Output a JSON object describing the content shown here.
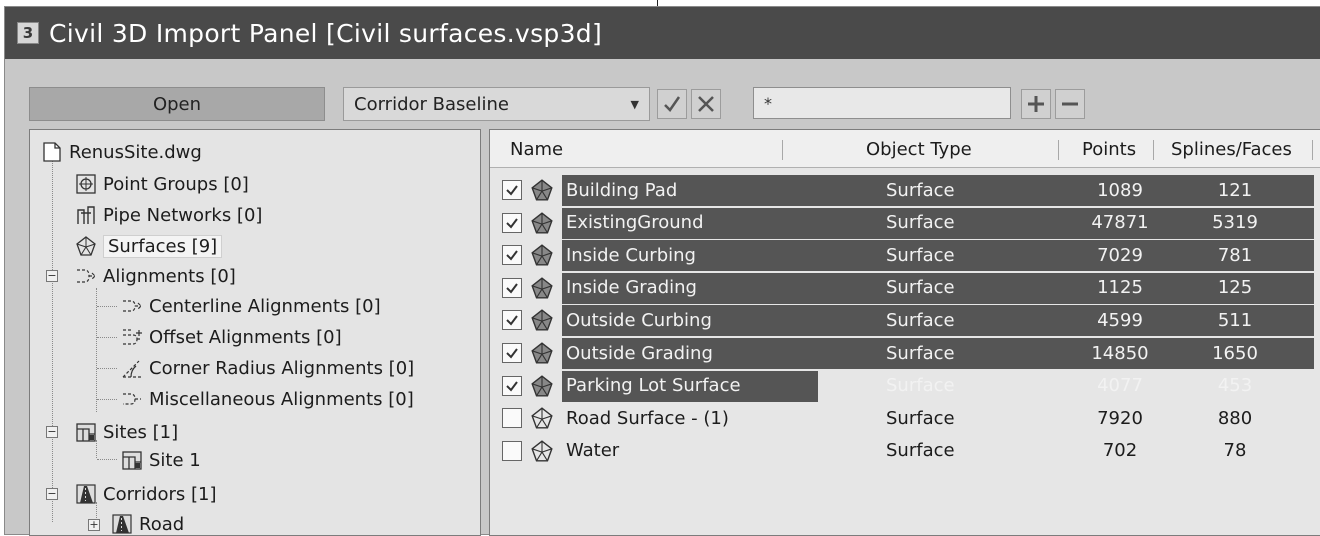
{
  "window": {
    "app_icon_text": "3",
    "title": "Civil 3D Import Panel [Civil surfaces.vsp3d]"
  },
  "toolbar": {
    "open_label": "Open",
    "combo_value": "Corridor Baseline",
    "filter_value": "*",
    "icons": [
      "check-icon",
      "x-icon",
      "plus-icon",
      "minus-icon"
    ]
  },
  "tree": {
    "root": "RenusSite.dwg",
    "items": [
      {
        "label": "Point Groups [0]",
        "icon": "point-groups-icon"
      },
      {
        "label": "Pipe Networks [0]",
        "icon": "pipe-networks-icon"
      },
      {
        "label": "Surfaces [9]",
        "icon": "surface-icon",
        "selected": true
      },
      {
        "label": "Alignments [0]",
        "icon": "alignment-icon"
      },
      {
        "label": "Centerline Alignments [0]",
        "icon": "centerline-alignment-icon"
      },
      {
        "label": "Offset Alignments [0]",
        "icon": "offset-alignment-icon"
      },
      {
        "label": "Corner Radius Alignments [0]",
        "icon": "corner-radius-alignment-icon"
      },
      {
        "label": "Miscellaneous Alignments [0]",
        "icon": "misc-alignment-icon"
      },
      {
        "label": "Sites [1]",
        "icon": "sites-icon"
      },
      {
        "label": "Site 1",
        "icon": "site-icon"
      },
      {
        "label": "Corridors [1]",
        "icon": "corridors-icon"
      },
      {
        "label": "Road",
        "icon": "corridor-road-icon"
      }
    ]
  },
  "table": {
    "columns": [
      "Name",
      "Object Type",
      "Points",
      "Splines/Faces"
    ],
    "rows": [
      {
        "name": "Building Pad",
        "type": "Surface",
        "points": "1089",
        "faces": "121",
        "checked": true
      },
      {
        "name": "ExistingGround",
        "type": "Surface",
        "points": "47871",
        "faces": "5319",
        "checked": true
      },
      {
        "name": "Inside Curbing",
        "type": "Surface",
        "points": "7029",
        "faces": "781",
        "checked": true
      },
      {
        "name": "Inside Grading",
        "type": "Surface",
        "points": "1125",
        "faces": "125",
        "checked": true
      },
      {
        "name": "Outside Curbing",
        "type": "Surface",
        "points": "4599",
        "faces": "511",
        "checked": true
      },
      {
        "name": "Outside Grading",
        "type": "Surface",
        "points": "14850",
        "faces": "1650",
        "checked": true
      },
      {
        "name": "Parking Lot Surface",
        "type": "Surface",
        "points": "4077",
        "faces": "453",
        "checked": true
      },
      {
        "name": "Road Surface - (1)",
        "type": "Surface",
        "points": "7920",
        "faces": "880",
        "checked": false
      },
      {
        "name": "Water",
        "type": "Surface",
        "points": "702",
        "faces": "78",
        "checked": false
      }
    ]
  },
  "colors": {
    "titlebar": "#4a4a4a",
    "row_highlight": "#555555",
    "panel_bg": "#e4e4e4"
  }
}
